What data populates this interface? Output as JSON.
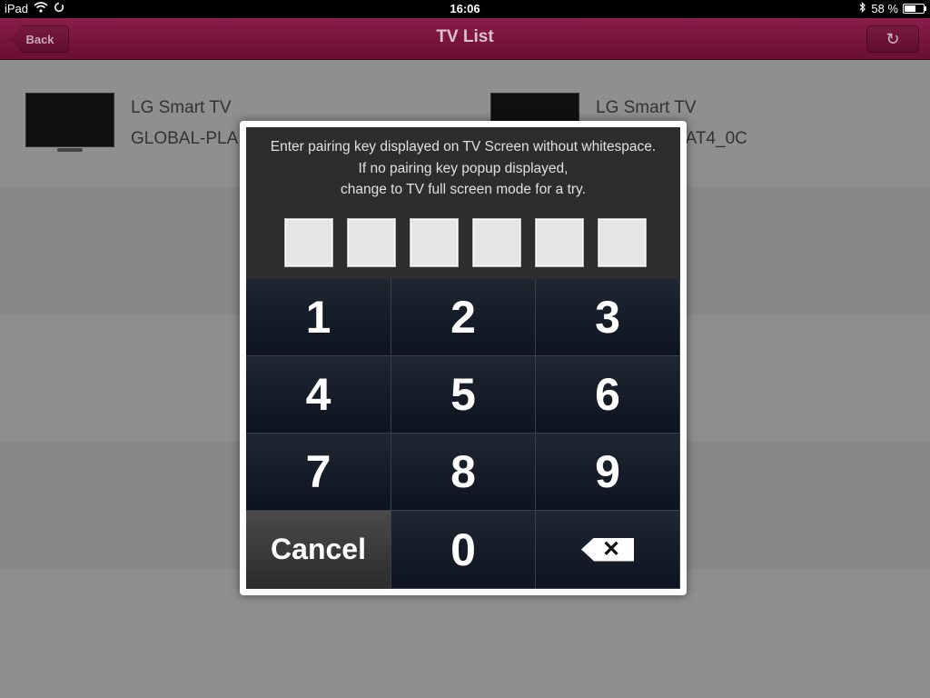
{
  "status_bar": {
    "device": "iPad",
    "time": "16:06",
    "battery_percent": "58 %",
    "battery_level": 0.58
  },
  "navbar": {
    "title": "TV List",
    "back_label": "Back",
    "refresh_icon": "↻"
  },
  "tv_list": [
    {
      "name": "LG Smart TV",
      "id": "GLOBAL-PLA"
    },
    {
      "name": "LG Smart TV",
      "id": "LAT4_0C"
    }
  ],
  "dialog": {
    "message_line1": "Enter pairing key displayed on TV Screen without whitespace.",
    "message_line2": "If no pairing key popup displayed,",
    "message_line3": "change to TV full screen mode for a try.",
    "pin_values": [
      "",
      "",
      "",
      "",
      "",
      ""
    ]
  },
  "keypad": {
    "keys": [
      "1",
      "2",
      "3",
      "4",
      "5",
      "6",
      "7",
      "8",
      "9"
    ],
    "cancel_label": "Cancel",
    "zero_label": "0",
    "delete_symbol": "✕"
  }
}
